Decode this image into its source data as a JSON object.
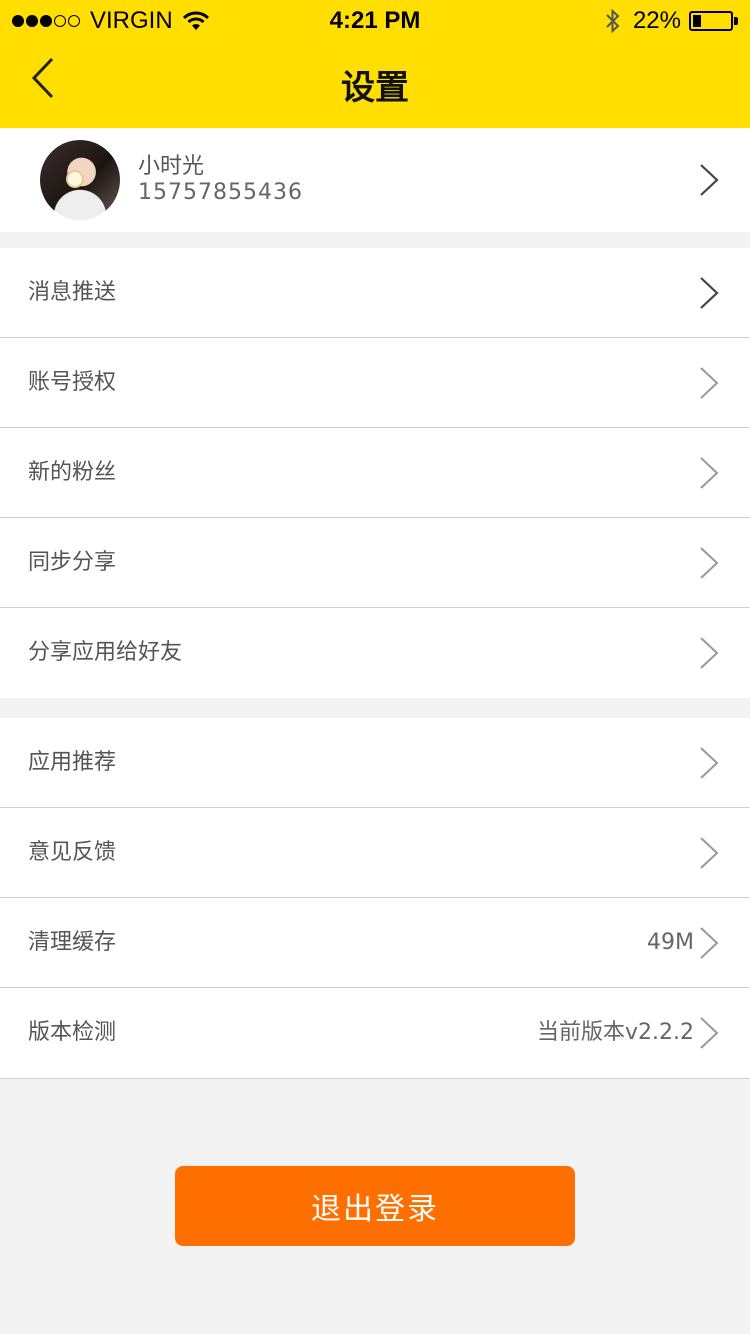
{
  "status_bar": {
    "carrier": "VIRGIN",
    "time": "4:21 PM",
    "battery": "22%",
    "battery_level": 0.22,
    "signal_bars_filled": 3,
    "signal_bars_total": 5
  },
  "nav": {
    "title": "设置",
    "back_icon": "chevron-left-icon"
  },
  "profile": {
    "name": "小时光",
    "phone": "15757855436"
  },
  "group1": [
    {
      "label": "消息推送"
    },
    {
      "label": "账号授权"
    },
    {
      "label": "新的粉丝"
    },
    {
      "label": "同步分享"
    },
    {
      "label": "分享应用给好友"
    }
  ],
  "group2": [
    {
      "label": "应用推荐"
    },
    {
      "label": "意见反馈"
    },
    {
      "label": "清理缓存",
      "value": "49M"
    },
    {
      "label": "版本检测",
      "value": "当前版本v2.2.2"
    }
  ],
  "logout_label": "退出登录",
  "colors": {
    "header": "#ffde00",
    "logout": "#ff6f00",
    "background": "#f3f3f3"
  }
}
